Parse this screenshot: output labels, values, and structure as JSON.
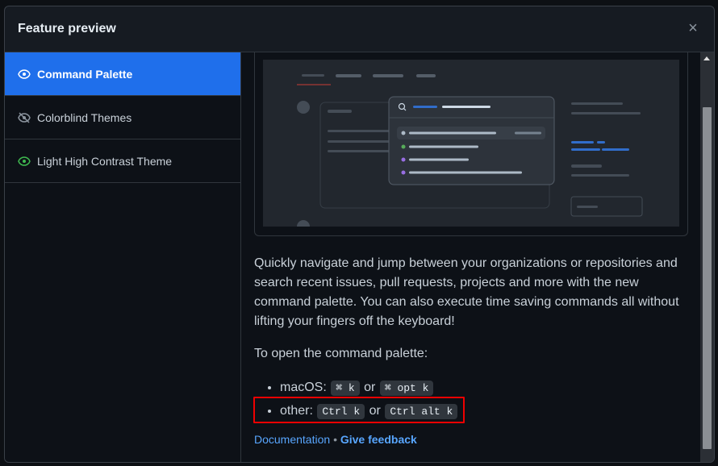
{
  "modal": {
    "title": "Feature preview",
    "close_icon": "×"
  },
  "sidebar": {
    "items": [
      {
        "label": "Command Palette",
        "icon": "eye-icon",
        "active": true
      },
      {
        "label": "Colorblind Themes",
        "icon": "eye-closed-icon",
        "active": false
      },
      {
        "label": "Light High Contrast Theme",
        "icon": "eye-icon",
        "active": false
      }
    ]
  },
  "content": {
    "description": "Quickly navigate and jump between your organizations or repositories and search recent issues, pull requests, projects and more with the new command palette. You can also execute time saving commands all without lifting your fingers off the keyboard!",
    "open_label": "To open the command palette:",
    "shortcuts": [
      {
        "os": "macOS:",
        "key1": "⌘ k",
        "or": "or",
        "key2": "⌘ opt k"
      },
      {
        "os": "other:",
        "key1": "Ctrl k",
        "or": "or",
        "key2": "Ctrl alt k"
      }
    ],
    "links": {
      "documentation": "Documentation",
      "separator": "•",
      "feedback": "Give feedback"
    }
  },
  "colors": {
    "accent": "#1f6feb",
    "highlight_box": "#e00000",
    "link": "#58a6ff"
  }
}
